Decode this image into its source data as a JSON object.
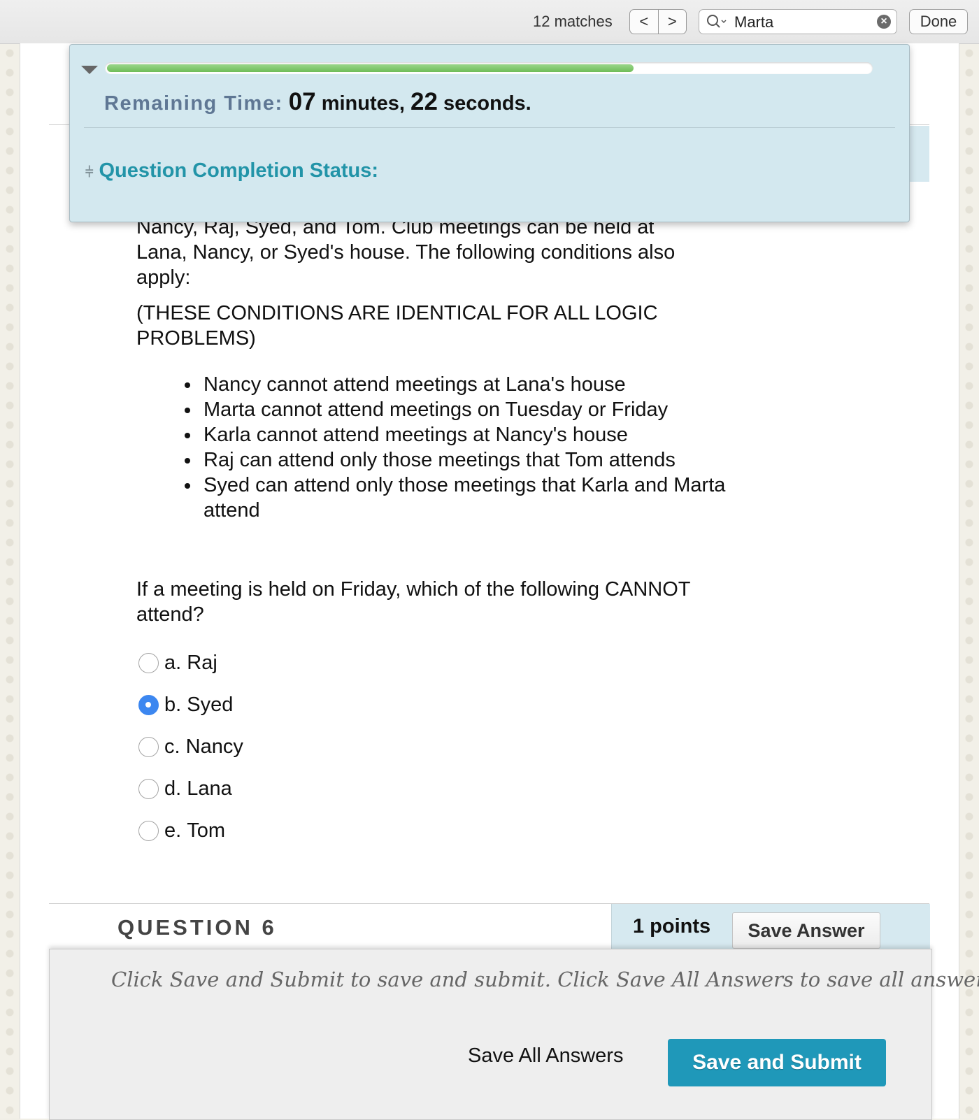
{
  "find_bar": {
    "match_count": "12 matches",
    "prev_label": "<",
    "next_label": ">",
    "search_icon": "magnifier-icon",
    "search_value": "Marta",
    "clear_icon": "clear-circle-icon",
    "done_label": "Done"
  },
  "timer": {
    "progress_fraction": 0.69,
    "label": "Remaining Time:",
    "minutes": "07",
    "minutes_unit": "minutes,",
    "seconds": "22",
    "seconds_unit": "seconds.",
    "completion_status_label": "Question Completion Status:"
  },
  "question": {
    "intro_line1": "Nancy, Raj, Syed, and Tom. Club meetings can be held at",
    "intro_line2": "Lana, Nancy, or Syed's house. The following conditions also",
    "intro_line3": "apply:",
    "note_line1": "(THESE CONDITIONS ARE IDENTICAL FOR ALL LOGIC",
    "note_line2": "PROBLEMS)",
    "conditions": [
      "Nancy cannot attend meetings at Lana's house",
      "Marta cannot attend meetings on Tuesday or Friday",
      "Karla cannot attend meetings at Nancy's house",
      "Raj can attend only those meetings that Tom attends",
      "Syed can attend only those meetings that Karla and Marta attend"
    ],
    "prompt": "If a meeting is held on Friday, which of the following CANNOT attend?",
    "answers": [
      {
        "letter": "a.",
        "text": "Raj",
        "selected": false
      },
      {
        "letter": "b.",
        "text": "Syed",
        "selected": true
      },
      {
        "letter": "c.",
        "text": "Nancy",
        "selected": false
      },
      {
        "letter": "d.",
        "text": "Lana",
        "selected": false
      },
      {
        "letter": "e.",
        "text": "Tom",
        "selected": false
      }
    ]
  },
  "question6": {
    "title": "QUESTION 6",
    "points": "1 points",
    "save_answer_label": "Save Answer"
  },
  "submit_panel": {
    "hint": "Click Save and Submit to save and submit. Click Save All Answers to save all answers.",
    "save_all_label": "Save All Answers",
    "save_submit_label": "Save and Submit"
  },
  "colors": {
    "accent_teal": "#1f98b9",
    "panel_blue": "#d3e8ef",
    "progress_green": "#6ebd58",
    "radio_selected": "#3c87f0"
  }
}
